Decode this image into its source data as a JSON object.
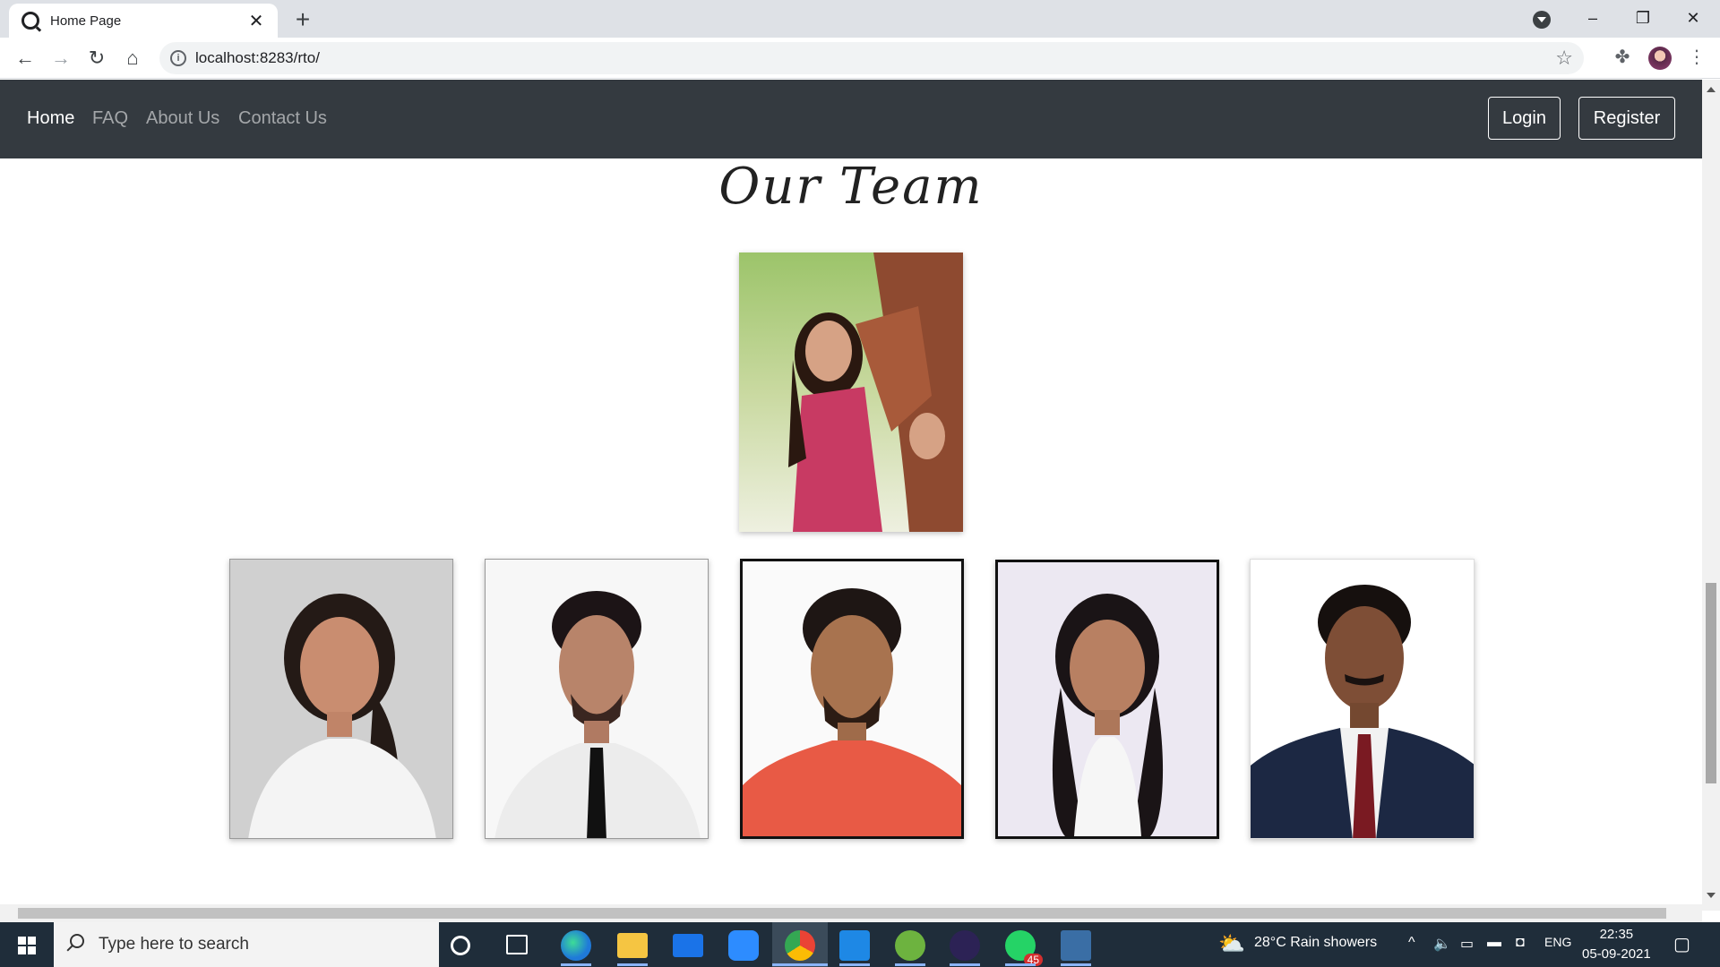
{
  "browser": {
    "tab_title": "Home Page",
    "tab_close": "✕",
    "new_tab": "+",
    "url": "localhost:8283/rto/",
    "minimize": "–",
    "restore": "❐",
    "close": "✕"
  },
  "nav": {
    "links": [
      "Home",
      "FAQ",
      "About Us",
      "Contact Us"
    ],
    "login_label": "Login",
    "register_label": "Register"
  },
  "page": {
    "heading": "Our Team"
  },
  "taskbar": {
    "search_placeholder": "Type here to search",
    "weather": "28°C  Rain showers",
    "language": "ENG",
    "time": "22:35",
    "date": "05-09-2021",
    "whatsapp_badge": "45"
  },
  "colors": {
    "navbar_bg": "#343a40",
    "taskbar_bg": "#1f2d3a"
  }
}
